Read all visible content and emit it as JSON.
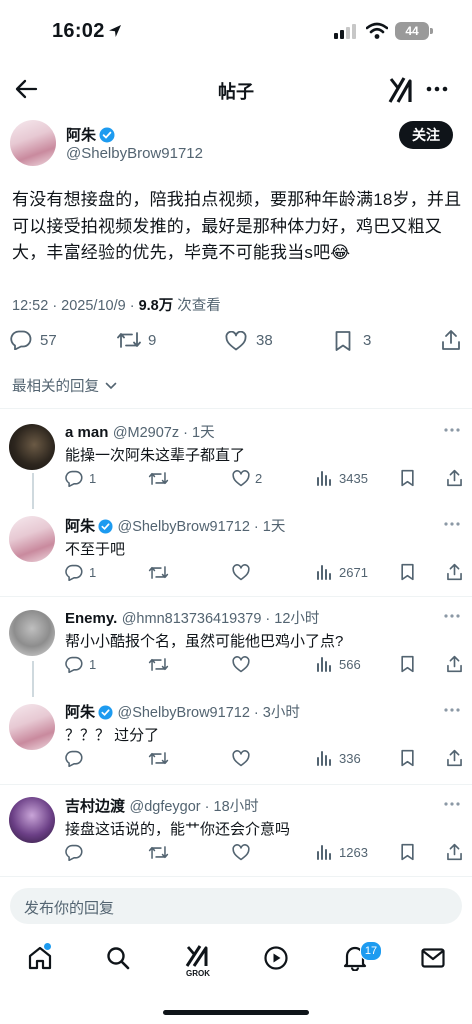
{
  "status_bar": {
    "time": "16:02",
    "battery": "44"
  },
  "header": {
    "title": "帖子"
  },
  "post": {
    "author_name": "阿朱",
    "author_handle": "@ShelbyBrow91712",
    "follow_label": "关注",
    "text": "有没有想接盘的，陪我拍点视频，要那种年龄满18岁，并且可以接受拍视频发推的，最好是那种体力好，鸡巴又粗又大，丰富经验的优先，毕竟不可能我当s吧😂",
    "timestamp": "12:52 · 2025/10/9 · ",
    "views_count": "9.8万",
    "views_label": " 次查看",
    "stats": {
      "replies": "57",
      "reposts": "9",
      "likes": "38",
      "bookmarks": "3"
    }
  },
  "replies_sort": {
    "label": "最相关的回复"
  },
  "replies": [
    {
      "name": "a man",
      "handle": "@M2907z · 1天",
      "text": "能操一次阿朱这辈子都直了",
      "replies": "1",
      "reposts": "",
      "likes": "2",
      "views": "3435"
    },
    {
      "name": "阿朱",
      "handle": "@ShelbyBrow91712 · 1天",
      "text": "不至于吧",
      "replies": "1",
      "reposts": "",
      "likes": "",
      "views": "2671"
    },
    {
      "name": "Enemy.",
      "handle": "@hmn813736419379 · 12小时",
      "text": "帮小小酷报个名，虽然可能他巴鸡小了点?",
      "replies": "1",
      "reposts": "",
      "likes": "",
      "views": "566"
    },
    {
      "name": "阿朱",
      "handle": "@ShelbyBrow91712 · 3小时",
      "text": "？？？ 过分了",
      "replies": "",
      "reposts": "",
      "likes": "",
      "views": "336"
    },
    {
      "name": "吉村边渡",
      "handle": "@dgfeygor · 18小时",
      "text": "接盘这话说的，能艹你还会介意吗",
      "replies": "",
      "reposts": "",
      "likes": "",
      "views": "1263"
    }
  ],
  "reply_composer": {
    "placeholder": "发布你的回复"
  },
  "bottom_nav": {
    "grok_label": "GROK",
    "notifications_badge": "17"
  },
  "colors": {
    "accent": "#1d9bf0",
    "text": "#0f1419",
    "muted": "#536471"
  },
  "icons": [
    "location-arrow-icon",
    "signal-icon",
    "wifi-icon",
    "battery-icon",
    "back-arrow-icon",
    "grok-icon",
    "more-icon",
    "verified-icon",
    "reply-icon",
    "repost-icon",
    "like-icon",
    "bookmark-icon",
    "share-icon",
    "chevron-down-icon",
    "views-icon",
    "home-icon",
    "search-icon",
    "play-icon",
    "bell-icon",
    "mail-icon"
  ]
}
